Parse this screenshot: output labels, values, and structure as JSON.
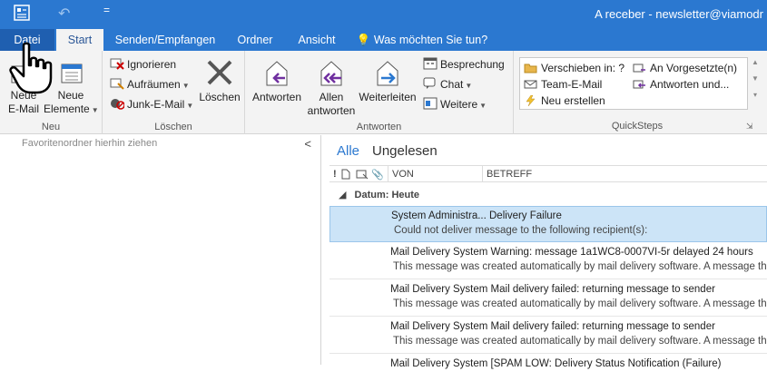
{
  "window": {
    "title": "A receber - newsletter@viamodr",
    "qat_symbol": "="
  },
  "tabs": [
    {
      "label": "Datei"
    },
    {
      "label": "Start"
    },
    {
      "label": "Senden/Empfangen"
    },
    {
      "label": "Ordner"
    },
    {
      "label": "Ansicht"
    },
    {
      "label": "Was möchten Sie tun?"
    }
  ],
  "ribbon": {
    "neu": {
      "label": "Neu",
      "new_email": "Neue\nE-Mail",
      "new_email_l1": "Neue",
      "new_email_l2": "E-Mail",
      "new_items_l1": "Neue",
      "new_items_l2": "Elemente"
    },
    "loeschen": {
      "label": "Löschen",
      "ignore": "Ignorieren",
      "cleanup": "Aufräumen",
      "junk": "Junk-E-Mail",
      "delete": "Löschen"
    },
    "antworten": {
      "label": "Antworten",
      "reply": "Antworten",
      "reply_all_l1": "Allen",
      "reply_all_l2": "antworten",
      "forward": "Weiterleiten",
      "meeting": "Besprechung",
      "chat": "Chat",
      "more": "Weitere"
    },
    "quicksteps": {
      "label": "QuickSteps",
      "items": [
        {
          "label": "Verschieben in: ?"
        },
        {
          "label": "An Vorgesetzte(n)"
        },
        {
          "label": "Team-E-Mail"
        },
        {
          "label": "Antworten und..."
        },
        {
          "label": "Neu erstellen"
        }
      ]
    }
  },
  "nav": {
    "favorites_hint": "Favoritenordner hierhin ziehen",
    "collapse": "<"
  },
  "mail": {
    "filters": {
      "all": "Alle",
      "unread": "Ungelesen"
    },
    "columns": {
      "from": "VON",
      "subject": "BETREFF"
    },
    "group_header": "Datum: Heute",
    "messages": [
      {
        "line1": "System Administra...  Delivery Failure",
        "line2": "Could not deliver message to the following recipient(s):",
        "selected": true
      },
      {
        "line1": "Mail Delivery System Warning: message 1a1WC8-0007VI-5r delayed 24 hours",
        "line2": "This message was created automatically by mail delivery software.  A message tha",
        "selected": false
      },
      {
        "line1": "Mail Delivery System Mail delivery failed: returning message to sender",
        "line2": "This message was created automatically by mail delivery software.  A message that",
        "selected": false
      },
      {
        "line1": "Mail Delivery System Mail delivery failed: returning message to sender",
        "line2": "This message was created automatically by mail delivery software.  A message that",
        "selected": false
      },
      {
        "line1": "Mail Delivery System [SPAM LOW:  Delivery Status Notification (Failure)",
        "line2": "",
        "selected": false
      }
    ]
  },
  "colors": {
    "accent": "#2b78d0",
    "selected_row": "#cce4f7"
  }
}
